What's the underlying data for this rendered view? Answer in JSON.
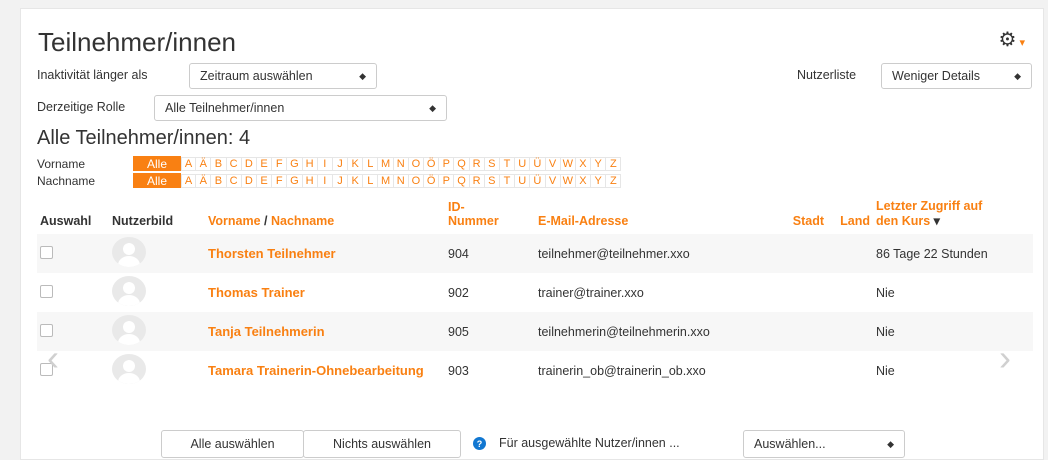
{
  "header": {
    "title": "Teilnehmer/innen"
  },
  "filters": {
    "inactivity_label": "Inaktivität länger als",
    "inactivity_value": "Zeitraum auswählen",
    "role_label": "Derzeitige Rolle",
    "role_value": "Alle Teilnehmer/innen",
    "userlist_label": "Nutzerliste",
    "userlist_value": "Weniger Details"
  },
  "summary": {
    "count_text": "Alle Teilnehmer/innen: 4"
  },
  "alphabet": {
    "firstname_label": "Vorname",
    "lastname_label": "Nachname",
    "all_label": "Alle",
    "letters": [
      "A",
      "Ä",
      "B",
      "C",
      "D",
      "E",
      "F",
      "G",
      "H",
      "I",
      "J",
      "K",
      "L",
      "M",
      "N",
      "O",
      "Ö",
      "P",
      "Q",
      "R",
      "S",
      "T",
      "U",
      "Ü",
      "V",
      "W",
      "X",
      "Y",
      "Z"
    ]
  },
  "table": {
    "headers": {
      "select": "Auswahl",
      "picture": "Nutzerbild",
      "firstname": "Vorname",
      "separator": " / ",
      "lastname": "Nachname",
      "id_line1": "ID-",
      "id_line2": "Nummer",
      "email": "E-Mail-Adresse",
      "city": "Stadt",
      "country": "Land",
      "access_line1": "Letzter Zugriff auf",
      "access_line2": "den Kurs"
    },
    "rows": [
      {
        "name": "Thorsten Teilnehmer",
        "id": "904",
        "email": "teilnehmer@teilnehmer.xxo",
        "access": "86 Tage 22 Stunden"
      },
      {
        "name": "Thomas Trainer",
        "id": "902",
        "email": "trainer@trainer.xxo",
        "access": "Nie"
      },
      {
        "name": "Tanja Teilnehmerin",
        "id": "905",
        "email": "teilnehmerin@teilnehmerin.xxo",
        "access": "Nie"
      },
      {
        "name": "Tamara Trainerin-Ohnebearbeitung",
        "id": "903",
        "email": "trainerin_ob@trainerin_ob.xxo",
        "access": "Nie"
      }
    ]
  },
  "bulk": {
    "select_all": "Alle auswählen",
    "select_none": "Nichts auswählen",
    "action_label": "Für ausgewählte Nutzer/innen ...",
    "action_value": "Auswählen..."
  },
  "icons": {
    "gear": "gear-icon",
    "help": "help-icon",
    "prev": "chevron-left-icon",
    "next": "chevron-right-icon"
  },
  "colors": {
    "accent": "#f98012",
    "help": "#1177d1"
  }
}
